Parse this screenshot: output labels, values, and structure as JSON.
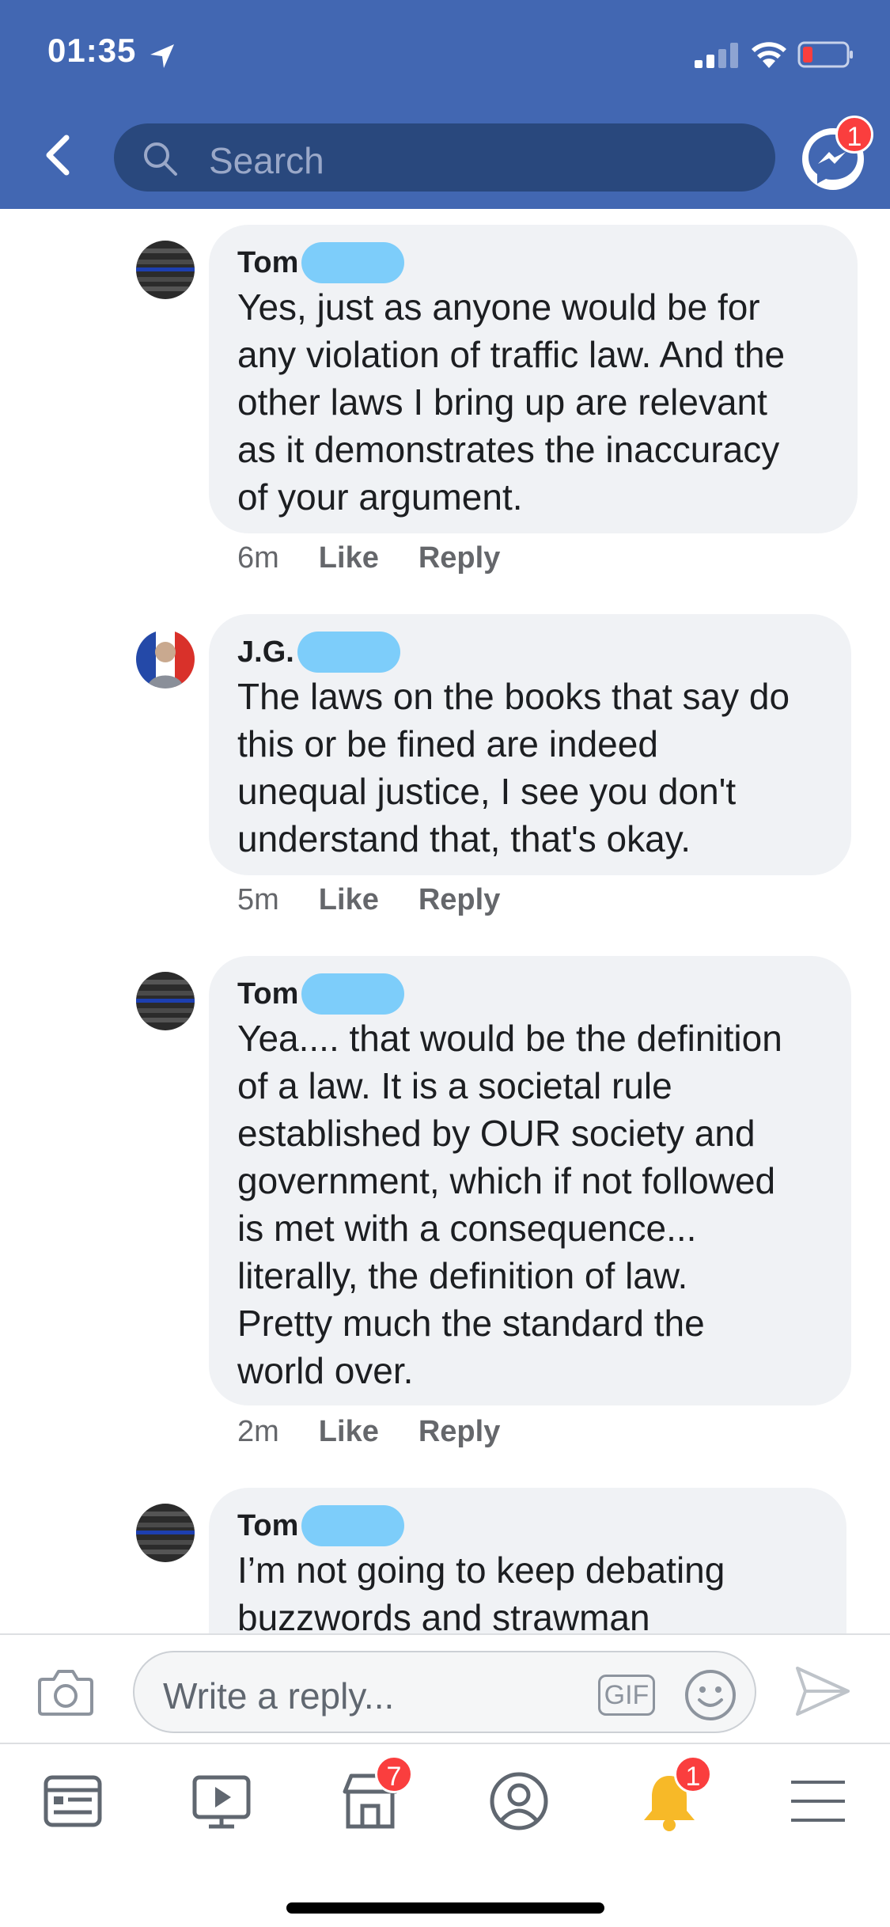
{
  "status_bar": {
    "time": "01:35"
  },
  "header": {
    "search_placeholder": "Search",
    "messenger_badge": "1"
  },
  "comments": [
    {
      "author": "Tom",
      "text": "Yes, just as anyone would be for\nany violation of traffic law. And the\nother laws I bring up are relevant\nas it demonstrates the inaccuracy\nof your argument.",
      "time": "6m",
      "like": "Like",
      "reply": "Reply"
    },
    {
      "author": "J.G.",
      "text": "The laws on the books that say do\nthis or be fined are indeed\nunequal justice, I see you don't\nunderstand that, that's okay.",
      "time": "5m",
      "like": "Like",
      "reply": "Reply"
    },
    {
      "author": "Tom",
      "text": "Yea.... that would be the definition\nof a law. It is a societal rule\nestablished by OUR society and\ngovernment, which if not followed\nis met with a consequence...\nliterally, the definition of law.\nPretty much the standard the\nworld over.",
      "time": "2m",
      "like": "Like",
      "reply": "Reply"
    },
    {
      "author": "Tom",
      "text": "I’m not going to keep debating\nbuzzwords and strawman"
    }
  ],
  "reply_bar": {
    "placeholder": "Write a reply...",
    "gif_label": "GIF"
  },
  "tab_bar": {
    "marketplace_badge": "7",
    "notifications_badge": "1"
  },
  "colors": {
    "header_bg": "#4267b2",
    "search_bg": "#29487d",
    "bubble_bg": "#f0f2f5",
    "redaction": "#7dcdfa",
    "badge": "#fa3e3e"
  }
}
